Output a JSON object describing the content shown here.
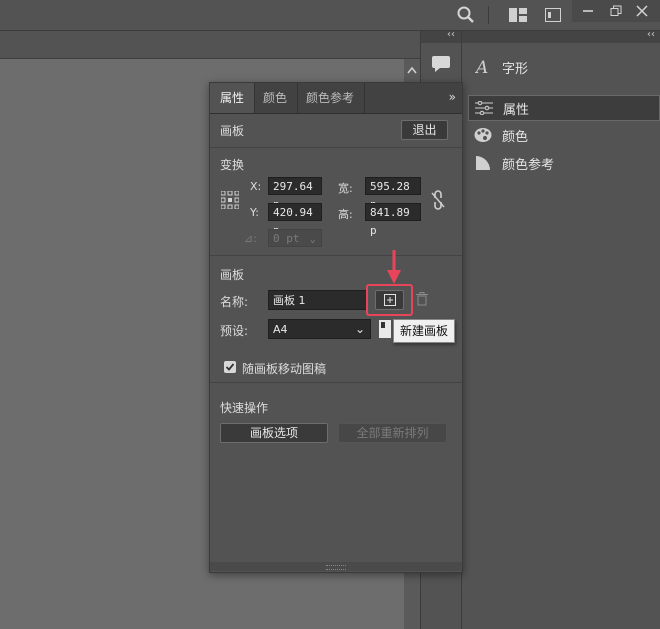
{
  "right_dock": {
    "items": [
      {
        "label": "字形",
        "icon": "glyph-icon"
      },
      {
        "label": "属性",
        "icon": "properties-icon",
        "selected": true
      },
      {
        "label": "颜色",
        "icon": "color-palette-icon"
      },
      {
        "label": "颜色参考",
        "icon": "color-guide-icon"
      }
    ]
  },
  "panel": {
    "tabs": [
      "属性",
      "颜色",
      "颜色参考"
    ],
    "artboard_header": "画板",
    "exit_label": "退出",
    "transform": {
      "title": "变换",
      "x_label": "X:",
      "x_value": "297.64 p",
      "y_label": "Y:",
      "y_value": "420.94 p",
      "w_label": "宽:",
      "w_value": "595.28 p",
      "h_label": "高:",
      "h_value": "841.89 p",
      "angle_label": "⊿:",
      "angle_value": "0 pt"
    },
    "artboards": {
      "title": "画板",
      "name_label": "名称:",
      "name_value": "画板 1",
      "preset_label": "预设:",
      "preset_value": "A4",
      "move_with_artboard": "随画板移动图稿"
    },
    "quick_actions": {
      "title": "快速操作",
      "options_button": "画板选项",
      "rearrange_button": "全部重新排列"
    }
  },
  "tooltip": "新建画板",
  "colors": {
    "highlight": "#e8455b",
    "panel_bg": "#535353",
    "field_bg": "#2b2b2b"
  }
}
